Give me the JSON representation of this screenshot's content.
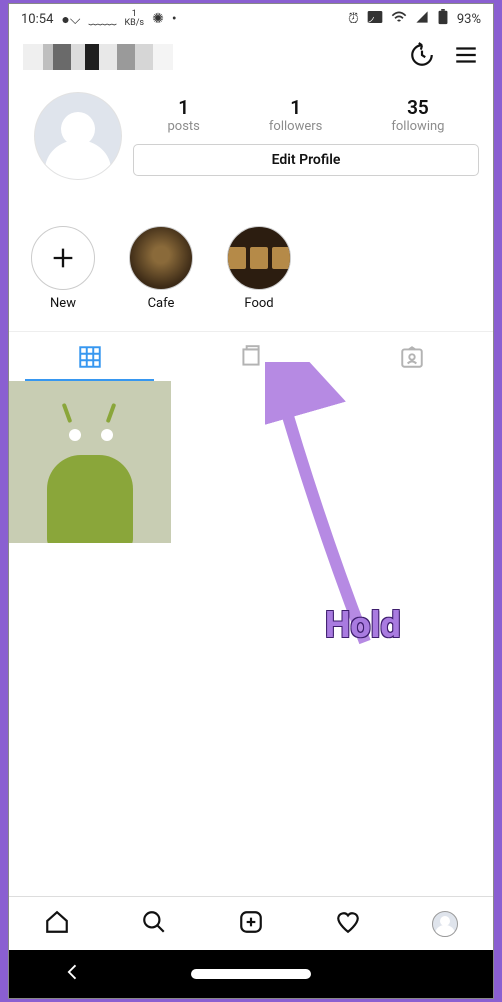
{
  "statusbar": {
    "time": "10:54",
    "netspeed_value": "1",
    "netspeed_unit": "KB/s",
    "battery_pct": "93%"
  },
  "profile": {
    "posts_value": "1",
    "posts_label": "posts",
    "followers_value": "1",
    "followers_label": "followers",
    "following_value": "35",
    "following_label": "following",
    "edit_profile_label": "Edit Profile"
  },
  "highlights": {
    "new_label": "New",
    "items": [
      {
        "label": "Cafe"
      },
      {
        "label": "Food"
      }
    ]
  },
  "annotation": {
    "label": "Hold"
  }
}
